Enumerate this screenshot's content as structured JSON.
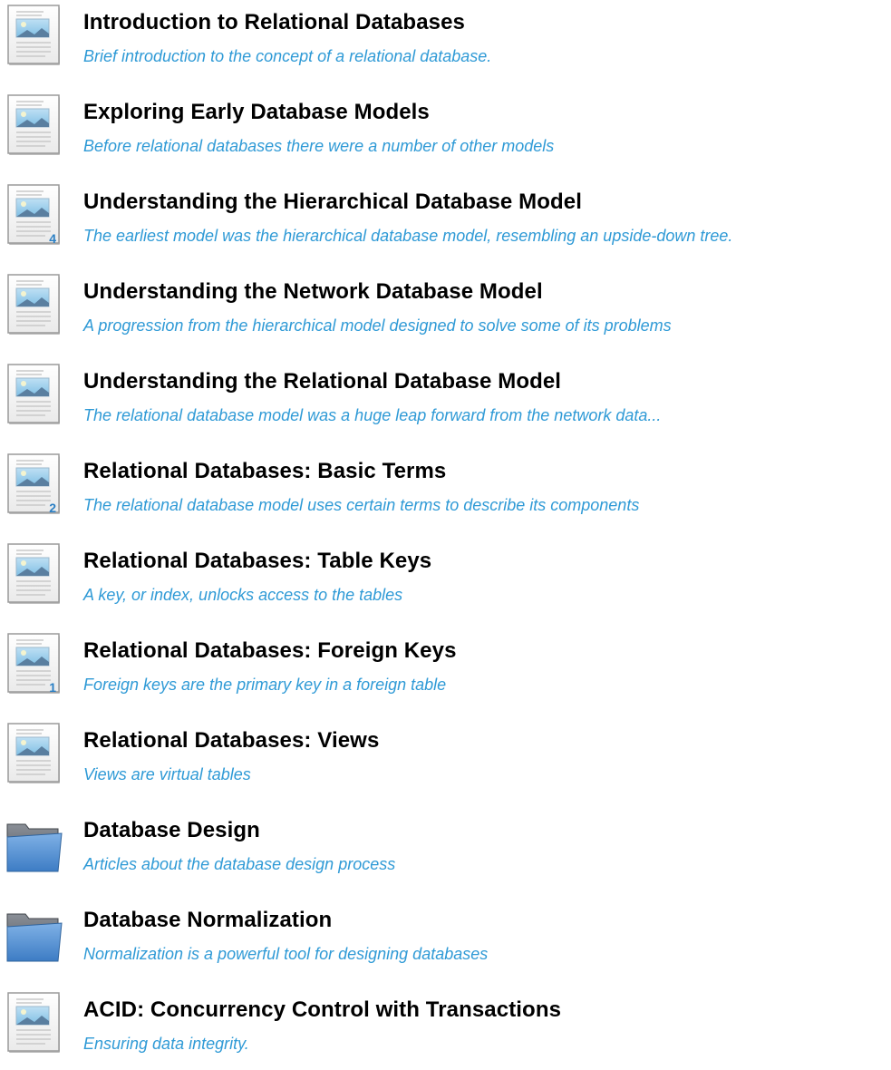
{
  "items": [
    {
      "type": "document",
      "icon": "document-icon",
      "title": "Introduction to Relational Databases",
      "description": "Brief introduction to the concept of a relational database.",
      "badge": ""
    },
    {
      "type": "document",
      "icon": "document-icon",
      "title": "Exploring Early Database Models",
      "description": "Before relational databases there were a number of other models",
      "badge": ""
    },
    {
      "type": "document",
      "icon": "document-icon",
      "title": "Understanding the Hierarchical Database Model",
      "description": "The earliest model was the hierarchical database model, resembling an upside-down tree.",
      "badge": "4"
    },
    {
      "type": "document",
      "icon": "document-icon",
      "title": "Understanding the Network Database Model",
      "description": "A progression from the hierarchical model designed to solve some of its problems",
      "badge": ""
    },
    {
      "type": "document",
      "icon": "document-icon",
      "title": "Understanding the Relational Database Model",
      "description": "The relational database model was a huge leap forward from the network data...",
      "badge": ""
    },
    {
      "type": "document",
      "icon": "document-icon",
      "title": "Relational Databases: Basic Terms",
      "description": "The relational database model uses certain terms to describe its components",
      "badge": "2"
    },
    {
      "type": "document",
      "icon": "document-icon",
      "title": "Relational Databases: Table Keys",
      "description": "A key, or index, unlocks access to the tables",
      "badge": ""
    },
    {
      "type": "document",
      "icon": "document-icon",
      "title": "Relational Databases: Foreign Keys",
      "description": "Foreign keys are the primary key in a foreign table",
      "badge": "1"
    },
    {
      "type": "document",
      "icon": "document-icon",
      "title": "Relational Databases: Views",
      "description": "Views are virtual tables",
      "badge": ""
    },
    {
      "type": "folder",
      "icon": "folder-icon",
      "title": "Database Design",
      "description": "Articles about the database design process",
      "badge": ""
    },
    {
      "type": "folder",
      "icon": "folder-icon",
      "title": "Database Normalization",
      "description": "Normalization is a powerful tool for designing databases",
      "badge": ""
    },
    {
      "type": "document",
      "icon": "document-icon",
      "title": "ACID: Concurrency Control with Transactions",
      "description": "Ensuring data integrity.",
      "badge": ""
    }
  ],
  "colors": {
    "title": "#000000",
    "description": "#2f9ad6",
    "badge": "#2a7fc4",
    "folder_front": "#4f8fd6",
    "folder_back": "#6a6f78"
  }
}
